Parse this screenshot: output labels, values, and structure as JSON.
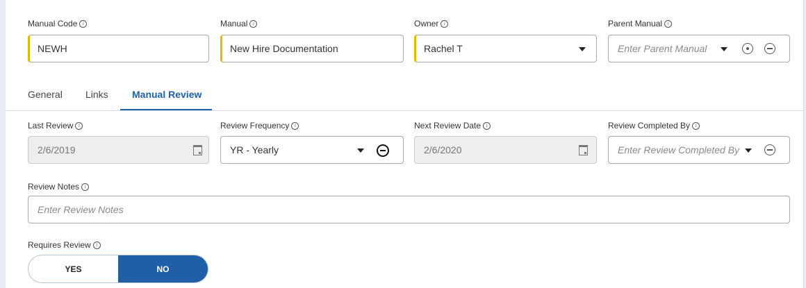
{
  "header_fields": {
    "manual_code": {
      "label": "Manual Code",
      "value": "NEWH"
    },
    "manual": {
      "label": "Manual",
      "value": "New Hire Documentation"
    },
    "owner": {
      "label": "Owner",
      "value": "Rachel T"
    },
    "parent_manual": {
      "label": "Parent Manual",
      "placeholder": "Enter Parent Manual"
    }
  },
  "tabs": [
    {
      "label": "General",
      "active": false
    },
    {
      "label": "Links",
      "active": false
    },
    {
      "label": "Manual Review",
      "active": true
    }
  ],
  "review": {
    "last_review": {
      "label": "Last Review",
      "value": "2/6/2019"
    },
    "review_frequency": {
      "label": "Review Frequency",
      "value": "YR - Yearly"
    },
    "next_review_date": {
      "label": "Next Review Date",
      "value": "2/6/2020"
    },
    "review_completed_by": {
      "label": "Review Completed By",
      "placeholder": "Enter Review Completed By"
    },
    "review_notes": {
      "label": "Review Notes",
      "placeholder": "Enter Review Notes"
    },
    "requires_review": {
      "label": "Requires Review",
      "yes": "YES",
      "no": "NO",
      "selected": "NO"
    }
  },
  "colors": {
    "accent": "#1f5fa8",
    "required_marker": "#e8b800"
  },
  "icons": [
    "info-icon",
    "dropdown-caret-icon",
    "select-target-icon",
    "clear-icon",
    "calendar-icon"
  ]
}
